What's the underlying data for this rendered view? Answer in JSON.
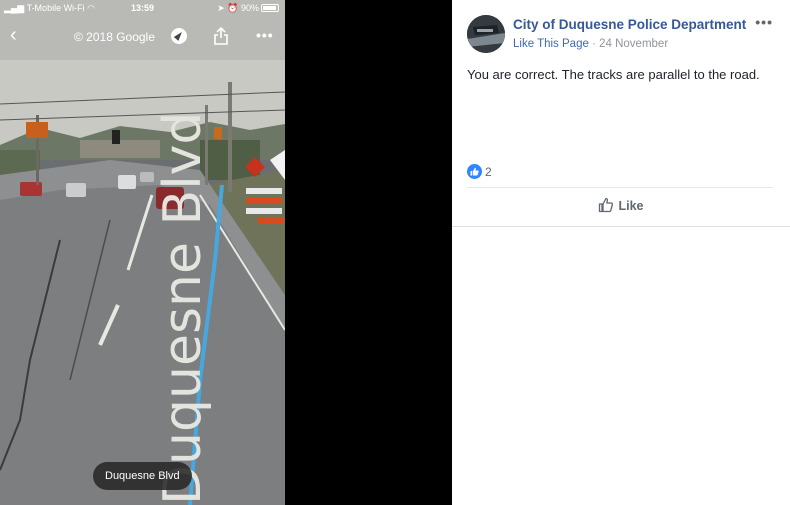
{
  "status_bar": {
    "carrier": "T-Mobile Wi-Fi",
    "time": "13:59",
    "battery": "90%"
  },
  "map_view": {
    "copyright": "© 2018 Google",
    "street_label": "Duquesne Blvd",
    "road_marking": "Duquesne Blvd",
    "icons": {
      "back": "chevron-left-icon",
      "compass": "compass-icon",
      "share": "share-icon",
      "more": "more-icon"
    }
  },
  "post": {
    "page_name": "City of Duquesne Police Department",
    "like_page": "Like This Page",
    "separator": " · ",
    "date": "24 November",
    "text": "You are correct. The tracks are parallel to the road.",
    "reaction_count": "2",
    "like_label": "Like",
    "accent_color": "#365899",
    "reaction_color": "#2d88ff"
  }
}
